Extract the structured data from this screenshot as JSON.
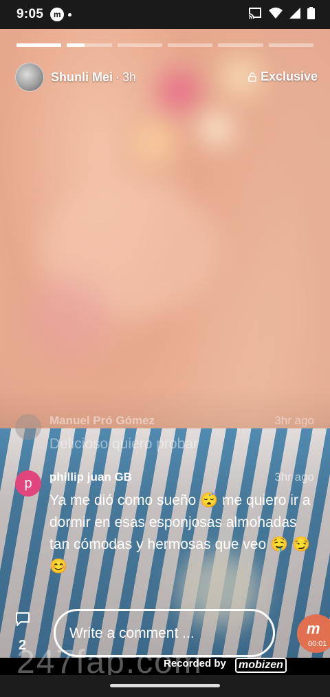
{
  "status_bar": {
    "time": "9:05",
    "left_icons": [
      "mobizen-icon",
      "notification-dot-icon"
    ],
    "right_icons": [
      "cast-icon",
      "wifi-icon",
      "signal-icon",
      "battery-icon"
    ]
  },
  "story": {
    "progress_segments": 6,
    "active_segment": 2,
    "active_segment_progress": 0.4,
    "user": {
      "name": "Shunli Mei",
      "separator": "·",
      "age": "3h"
    },
    "exclusive_label": "Exclusive"
  },
  "comments": [
    {
      "name": "Manuel Pró Gómez",
      "time": "3hr ago",
      "text": "Delicioso quiero probar",
      "avatar_initial": "",
      "avatar_color": "#9a8f8c"
    },
    {
      "name": "phillip juan GB",
      "time": "3hr ago",
      "text": "Ya me dió como sueño 😴 me quiero ir a dormir en esas esponjosas almohadas tan cómodas y hermosas que veo 🤤 😏😊",
      "avatar_initial": "p",
      "avatar_color": "#e0457b"
    }
  ],
  "bottom": {
    "comment_count": "2",
    "input_placeholder": "Write a comment ..."
  },
  "overlay": {
    "recorder_time": "00:01",
    "recorder_letter": "m",
    "recorded_by": "Recorded by",
    "recorder_brand": "mobizen",
    "site_watermark": "247fap.com"
  }
}
